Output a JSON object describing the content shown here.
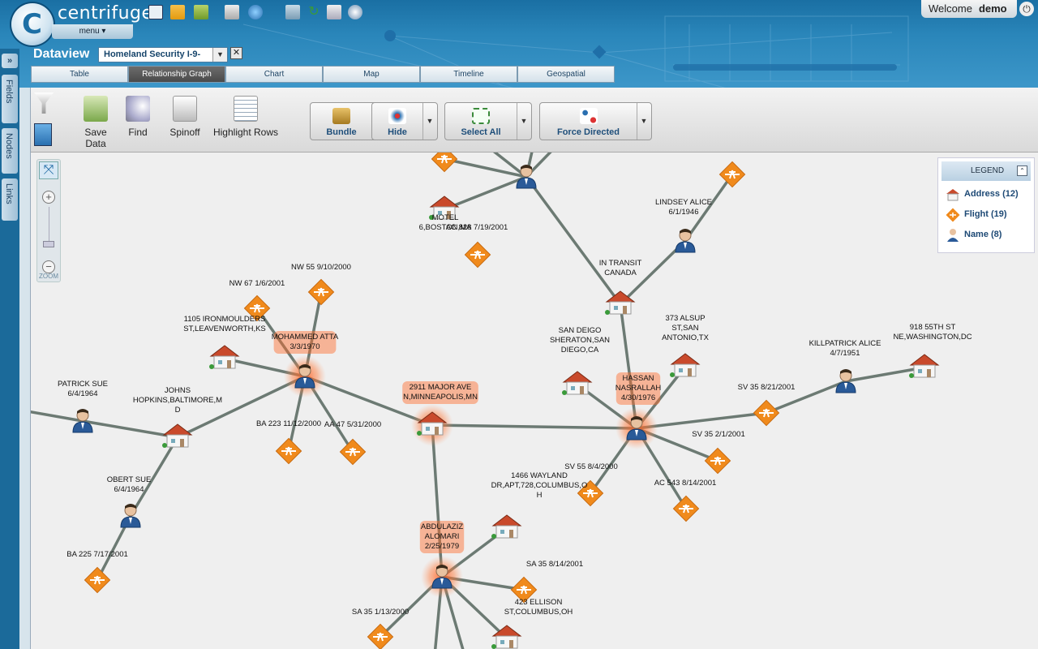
{
  "header": {
    "brand": "centrifuge",
    "menu_label": "menu ▾",
    "welcome_label": "Welcome",
    "user": "demo"
  },
  "dataview": {
    "label": "Dataview",
    "selected": "Homeland Security I-9-",
    "tabs": [
      "Table",
      "Relationship Graph",
      "Chart",
      "Map",
      "Timeline",
      "Geospatial"
    ],
    "active_tab": "Relationship Graph"
  },
  "sidebar": {
    "items": [
      "Fields",
      "Nodes",
      "Links"
    ]
  },
  "toolbar": {
    "tools": [
      "Save Data",
      "Find",
      "Spinoff",
      "Highlight Rows"
    ],
    "buttons": [
      "Bundle",
      "Hide",
      "Select All",
      "Force Directed"
    ]
  },
  "zoom": {
    "label": "ZOOM"
  },
  "legend": {
    "title": "LEGEND",
    "items": [
      {
        "label": "Address (12)",
        "type": "address"
      },
      {
        "label": "Flight (19)",
        "type": "flight"
      },
      {
        "label": "Name (8)",
        "type": "name"
      }
    ]
  },
  "colors": {
    "flight": "#f08a1c",
    "address": "#c94a2c",
    "edge": "#6c7a73",
    "highlight": "#ff6a2a"
  },
  "graph": {
    "nodes": [
      {
        "id": "motel",
        "type": "address",
        "label": "MOTEL\n6,BOSTON,MA"
      },
      {
        "id": "topflight",
        "type": "flight",
        "label": ""
      },
      {
        "id": "topperson",
        "type": "name",
        "label": ""
      },
      {
        "id": "ac828",
        "type": "flight",
        "label": "AC 828 7/19/2001"
      },
      {
        "id": "lindsey",
        "type": "name",
        "label": "LINDSEY ALICE\n6/1/1946"
      },
      {
        "id": "flight_tr",
        "type": "flight",
        "label": ""
      },
      {
        "id": "intransit",
        "type": "address",
        "label": "IN TRANSIT\nCANADA"
      },
      {
        "id": "nw55",
        "type": "flight",
        "label": "NW 55 9/10/2000"
      },
      {
        "id": "nw67",
        "type": "flight",
        "label": "NW 67 1/6/2001"
      },
      {
        "id": "ironmoulders",
        "type": "address",
        "label": "1105 IRONMOULDERS\nST,LEAVENWORTH,KS"
      },
      {
        "id": "atta",
        "type": "name",
        "label": "MOHAMMED ATTA\n3/3/1970",
        "hl": true
      },
      {
        "id": "major",
        "type": "address",
        "label": "2911 MAJOR AVE\nN,MINNEAPOLIS,MN",
        "hl": true
      },
      {
        "id": "ba223",
        "type": "flight",
        "label": "BA 223 11/12/2000"
      },
      {
        "id": "aa47",
        "type": "flight",
        "label": "AA 47 5/31/2000"
      },
      {
        "id": "johns",
        "type": "address",
        "label": "JOHNS\nHOPKINS,BALTIMORE,M\nD"
      },
      {
        "id": "patrick",
        "type": "name",
        "label": "PATRICK SUE\n6/4/1964"
      },
      {
        "id": "obert",
        "type": "name",
        "label": "OBERT SUE\n6/4/1964"
      },
      {
        "id": "ba225",
        "type": "flight",
        "label": "BA 225 7/17/2001"
      },
      {
        "id": "sheraton",
        "type": "address",
        "label": "SAN DEIGO\nSHERATON,SAN\nDIEGO,CA"
      },
      {
        "id": "alsup",
        "type": "address",
        "label": "373 ALSUP\nST,SAN\nANTONIO,TX"
      },
      {
        "id": "hassan",
        "type": "name",
        "label": "HASSAN\nNASRALLAH\n4/30/1976",
        "hl": true
      },
      {
        "id": "sv35a",
        "type": "flight",
        "label": "SV 35 8/21/2001"
      },
      {
        "id": "killpatrick",
        "type": "name",
        "label": "KILLPATRICK ALICE\n4/7/1951"
      },
      {
        "id": "55th",
        "type": "address",
        "label": "918 55TH ST\nNE,WASHINGTON,DC"
      },
      {
        "id": "sv35b",
        "type": "flight",
        "label": "SV 35 2/1/2001"
      },
      {
        "id": "sv55",
        "type": "flight",
        "label": "SV 55 8/4/2000"
      },
      {
        "id": "ac543",
        "type": "flight",
        "label": "AC 543 8/14/2001"
      },
      {
        "id": "wayland",
        "type": "address",
        "label": "1466 WAYLAND\nDR,APT,728,COLUMBUS,O\nH"
      },
      {
        "id": "alomari",
        "type": "name",
        "label": "ABDULAZIZ\nALOMARI\n2/25/1979",
        "hl": true
      },
      {
        "id": "sa35a",
        "type": "flight",
        "label": "SA 35 8/14/2001"
      },
      {
        "id": "ellison",
        "type": "address",
        "label": "423 ELLISON\nST,COLUMBUS,OH"
      },
      {
        "id": "sa35b",
        "type": "flight",
        "label": "SA 35 1/13/2000"
      }
    ],
    "edges": [
      [
        "motel",
        "topperson"
      ],
      [
        "topflight",
        "topperson"
      ],
      [
        "topperson",
        "intransit"
      ],
      [
        "lindsey",
        "intransit"
      ],
      [
        "flight_tr",
        "lindsey"
      ],
      [
        "intransit",
        "hassan"
      ],
      [
        "atta",
        "nw55"
      ],
      [
        "atta",
        "nw67"
      ],
      [
        "atta",
        "ironmoulders"
      ],
      [
        "atta",
        "major"
      ],
      [
        "atta",
        "ba223"
      ],
      [
        "atta",
        "aa47"
      ],
      [
        "atta",
        "johns"
      ],
      [
        "johns",
        "patrick"
      ],
      [
        "johns",
        "obert"
      ],
      [
        "obert",
        "ba225"
      ],
      [
        "major",
        "hassan"
      ],
      [
        "major",
        "alomari"
      ],
      [
        "hassan",
        "sheraton"
      ],
      [
        "hassan",
        "alsup"
      ],
      [
        "hassan",
        "sv35a"
      ],
      [
        "sv35a",
        "killpatrick"
      ],
      [
        "killpatrick",
        "55th"
      ],
      [
        "hassan",
        "sv35b"
      ],
      [
        "hassan",
        "sv55"
      ],
      [
        "hassan",
        "ac543"
      ],
      [
        "alomari",
        "wayland"
      ],
      [
        "alomari",
        "sa35a"
      ],
      [
        "alomari",
        "ellison"
      ],
      [
        "alomari",
        "sa35b"
      ],
      [
        "topperson",
        "top_off1"
      ],
      [
        "topperson",
        "top_off2"
      ],
      [
        "topperson",
        "top_off3"
      ],
      [
        "alomari",
        "bot_off1"
      ],
      [
        "alomari",
        "bot_off2"
      ],
      [
        "patrick",
        "left_off"
      ]
    ]
  }
}
